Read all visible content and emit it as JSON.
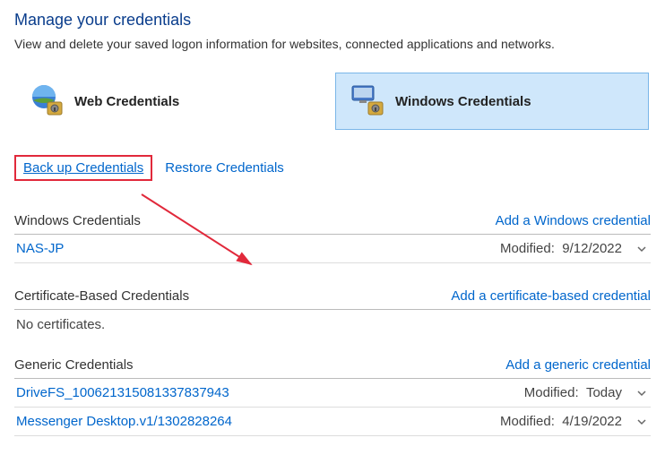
{
  "header": {
    "title": "Manage your credentials",
    "description": "View and delete your saved logon information for websites, connected applications and networks."
  },
  "tabs": {
    "web": {
      "label": "Web Credentials"
    },
    "windows": {
      "label": "Windows Credentials"
    }
  },
  "actions": {
    "backup": "Back up Credentials",
    "restore": "Restore Credentials"
  },
  "sections": {
    "windows": {
      "title": "Windows Credentials",
      "add": "Add a Windows credential",
      "rows": [
        {
          "name": "NAS-JP",
          "modified_label": "Modified:",
          "modified": "9/12/2022"
        }
      ]
    },
    "cert": {
      "title": "Certificate-Based Credentials",
      "add": "Add a certificate-based credential",
      "empty": "No certificates."
    },
    "generic": {
      "title": "Generic Credentials",
      "add": "Add a generic credential",
      "rows": [
        {
          "name": "DriveFS_100621315081337837943",
          "modified_label": "Modified:",
          "modified": "Today"
        },
        {
          "name": "Messenger Desktop.v1/1302828264",
          "modified_label": "Modified:",
          "modified": "4/19/2022"
        }
      ]
    }
  }
}
